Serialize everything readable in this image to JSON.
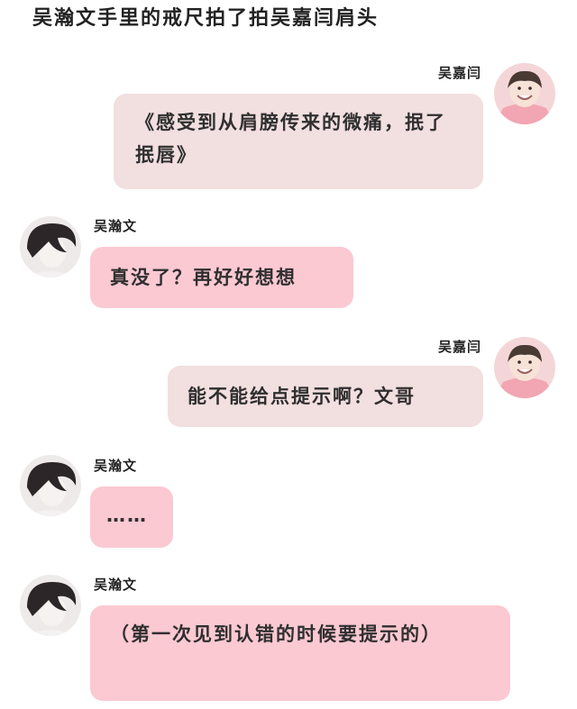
{
  "narration": "吴瀚文手里的戒尺拍了拍吴嘉闫肩头",
  "messages": [
    {
      "side": "right",
      "sender": "吴嘉闫",
      "text": "《感受到从肩膀传来的微痛，抿了抿唇》",
      "color": "#f2dfe0"
    },
    {
      "side": "left",
      "sender": "吴瀚文",
      "text": "真没了？再好好想想",
      "color": "#fbc9d2"
    },
    {
      "side": "right",
      "sender": "吴嘉闫",
      "text": "能不能给点提示啊？文哥",
      "color": "#f2dfe0"
    },
    {
      "side": "left",
      "sender": "吴瀚文",
      "text": "……",
      "color": "#fbc9d2"
    },
    {
      "side": "left",
      "sender": "吴瀚文",
      "text": "（第一次见到认错的时候要提示的）",
      "color": "#fbc9d2"
    }
  ],
  "avatars": {
    "right": "smiling-boy-avatar-icon",
    "left": "dark-hair-boy-avatar-icon"
  }
}
